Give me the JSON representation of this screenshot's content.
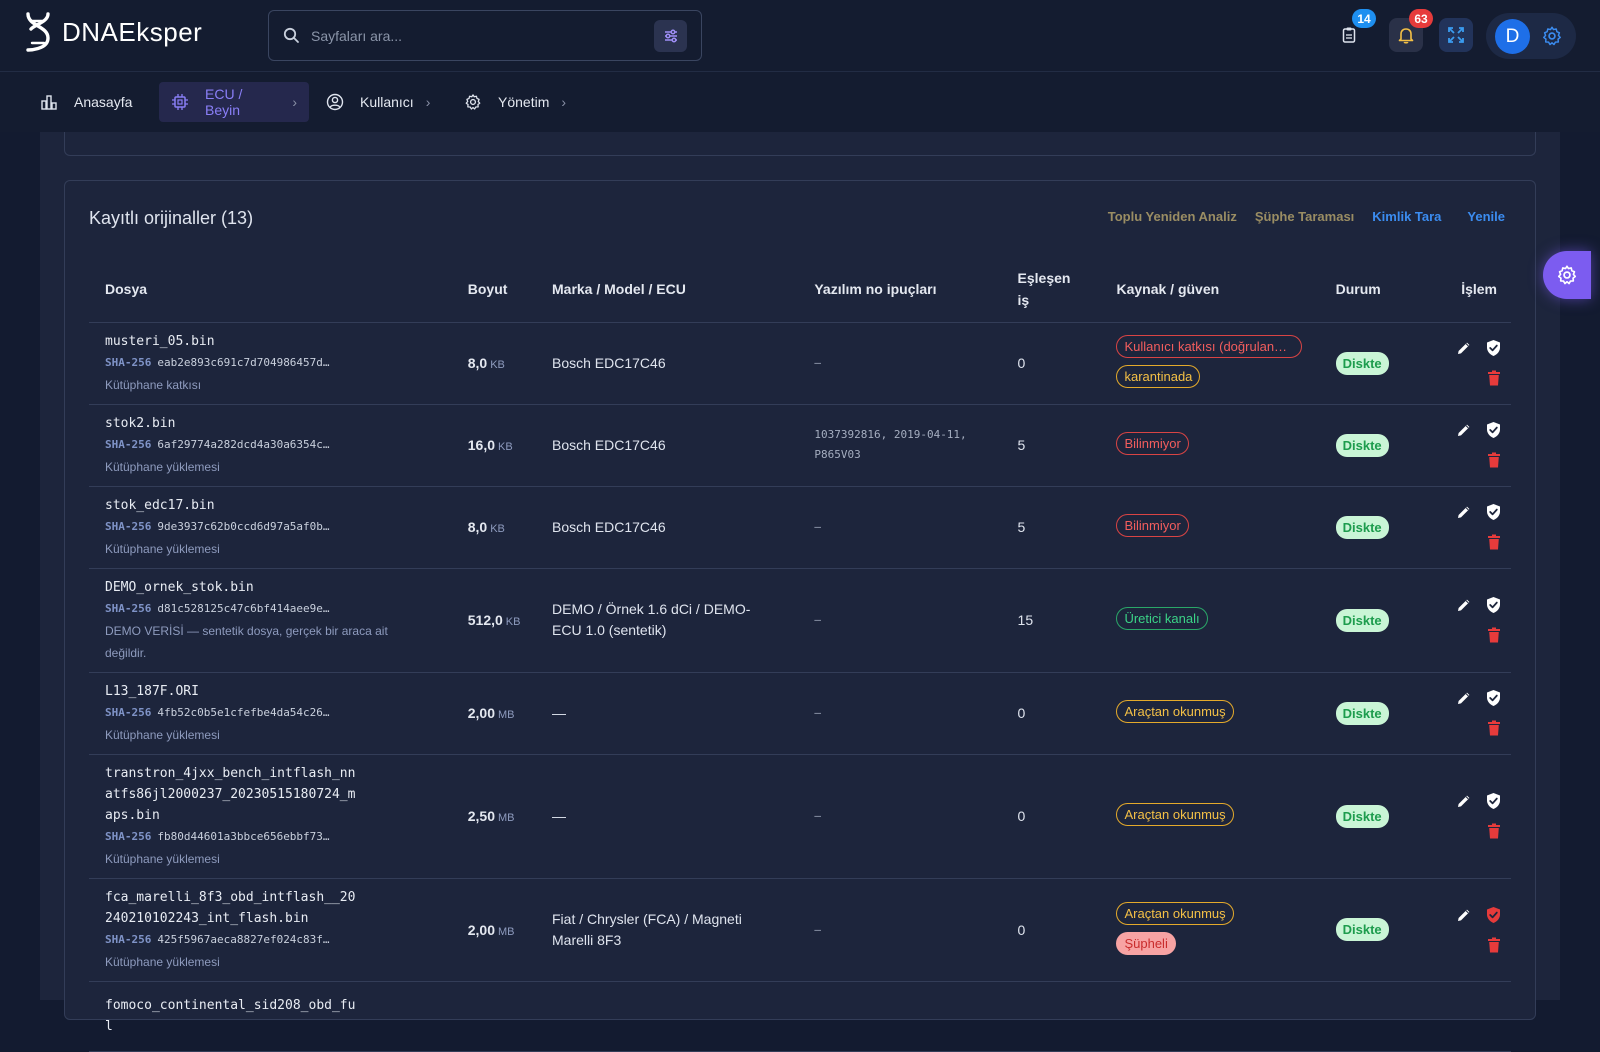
{
  "app": {
    "logo_text": "DNAEksper"
  },
  "search": {
    "placeholder": "Sayfaları ara..."
  },
  "header": {
    "tasks_count": "14",
    "notifications_count": "63",
    "avatar_letter": "D"
  },
  "nav": [
    {
      "label": "Anasayfa"
    },
    {
      "label": "ECU / Beyin"
    },
    {
      "label": "Kullanıcı"
    },
    {
      "label": "Yönetim"
    }
  ],
  "card": {
    "title": "Kayıtlı orijinaller (13)",
    "actions": [
      {
        "label": "Toplu Yeniden Analiz"
      },
      {
        "label": "Şüphe Taraması"
      },
      {
        "label": "Kimlik Tara"
      },
      {
        "label": "Yenile"
      }
    ]
  },
  "table": {
    "headers": [
      "Dosya",
      "Boyut",
      "Marka / Model / ECU",
      "Yazılım no ipuçları",
      "Eşleşen iş",
      "Kaynak / güven",
      "Durum",
      "İşlem"
    ],
    "sha_label": "SHA-256",
    "rows": [
      {
        "file": "musteri_05.bin",
        "sha": "eab2e893c691c7d704986457d…",
        "sub": "Kütüphane katkısı",
        "size": "8,0",
        "unit": "KB",
        "ecu": "Bosch EDC17C46",
        "hint": "–",
        "jobs": "0",
        "tags": [
          "Kullanıcı katkısı (doğrulanm…",
          "karantinada"
        ],
        "status": "Diskte"
      },
      {
        "file": "stok2.bin",
        "sha": "6af29774a282dcd4a30a6354c…",
        "sub": "Kütüphane yüklemesi",
        "size": "16,0",
        "unit": "KB",
        "ecu": "Bosch EDC17C46",
        "hint": "1037392816, 2019-04-11, P865V03",
        "jobs": "5",
        "tags": [
          "Bilinmiyor"
        ],
        "status": "Diskte"
      },
      {
        "file": "stok_edc17.bin",
        "sha": "9de3937c62b0ccd6d97a5af0b…",
        "sub": "Kütüphane yüklemesi",
        "size": "8,0",
        "unit": "KB",
        "ecu": "Bosch EDC17C46",
        "hint": "–",
        "jobs": "5",
        "tags": [
          "Bilinmiyor"
        ],
        "status": "Diskte"
      },
      {
        "file": "DEMO_ornek_stok.bin",
        "sha": "d81c528125c47c6bf414aee9e…",
        "sub": "DEMO VERİSİ — sentetik dosya, gerçek bir araca ait değildir.",
        "size": "512,0",
        "unit": "KB",
        "ecu": "DEMO / Örnek 1.6 dCi / DEMO-ECU 1.0 (sentetik)",
        "hint": "–",
        "jobs": "15",
        "tags": [
          "Üretici kanalı"
        ],
        "status": "Diskte"
      },
      {
        "file": "L13_187F.ORI",
        "sha": "4fb52c0b5e1cfefbe4da54c26…",
        "sub": "Kütüphane yüklemesi",
        "size": "2,00",
        "unit": "MB",
        "ecu": "—",
        "hint": "–",
        "jobs": "0",
        "tags": [
          "Araçtan okunmuş"
        ],
        "status": "Diskte"
      },
      {
        "file": "transtron_4jxx_bench_intflash_nnatfs86jl2000237_20230515180724_maps.bin",
        "sha": "fb80d44601a3bbce656ebbf73…",
        "sub": "Kütüphane yüklemesi",
        "size": "2,50",
        "unit": "MB",
        "ecu": "—",
        "hint": "–",
        "jobs": "0",
        "tags": [
          "Araçtan okunmuş"
        ],
        "status": "Diskte"
      },
      {
        "file": "fca_marelli_8f3_obd_intflash__20240210102243_int_flash.bin",
        "sha": "425f5967aeca8827ef024c83f…",
        "sub": "Kütüphane yüklemesi",
        "size": "2,00",
        "unit": "MB",
        "ecu": "Fiat / Chrysler (FCA) / Magneti Marelli 8F3",
        "hint": "–",
        "jobs": "0",
        "tags": [
          "Araçtan okunmuş",
          "Şüpheli"
        ],
        "status": "Diskte",
        "suspicious": true
      },
      {
        "file": "fomoco_continental_sid208_obd_ful",
        "sha": "",
        "sub": "",
        "size": "",
        "unit": "",
        "ecu": "",
        "hint": "",
        "jobs": "",
        "tags": [],
        "status": ""
      }
    ]
  },
  "colors": {
    "accent": "#8a7ff7",
    "primary": "#1e6fe8",
    "link": "#3b8cf0",
    "muted_action": "#9a8d63",
    "danger": "#e63b3b"
  }
}
